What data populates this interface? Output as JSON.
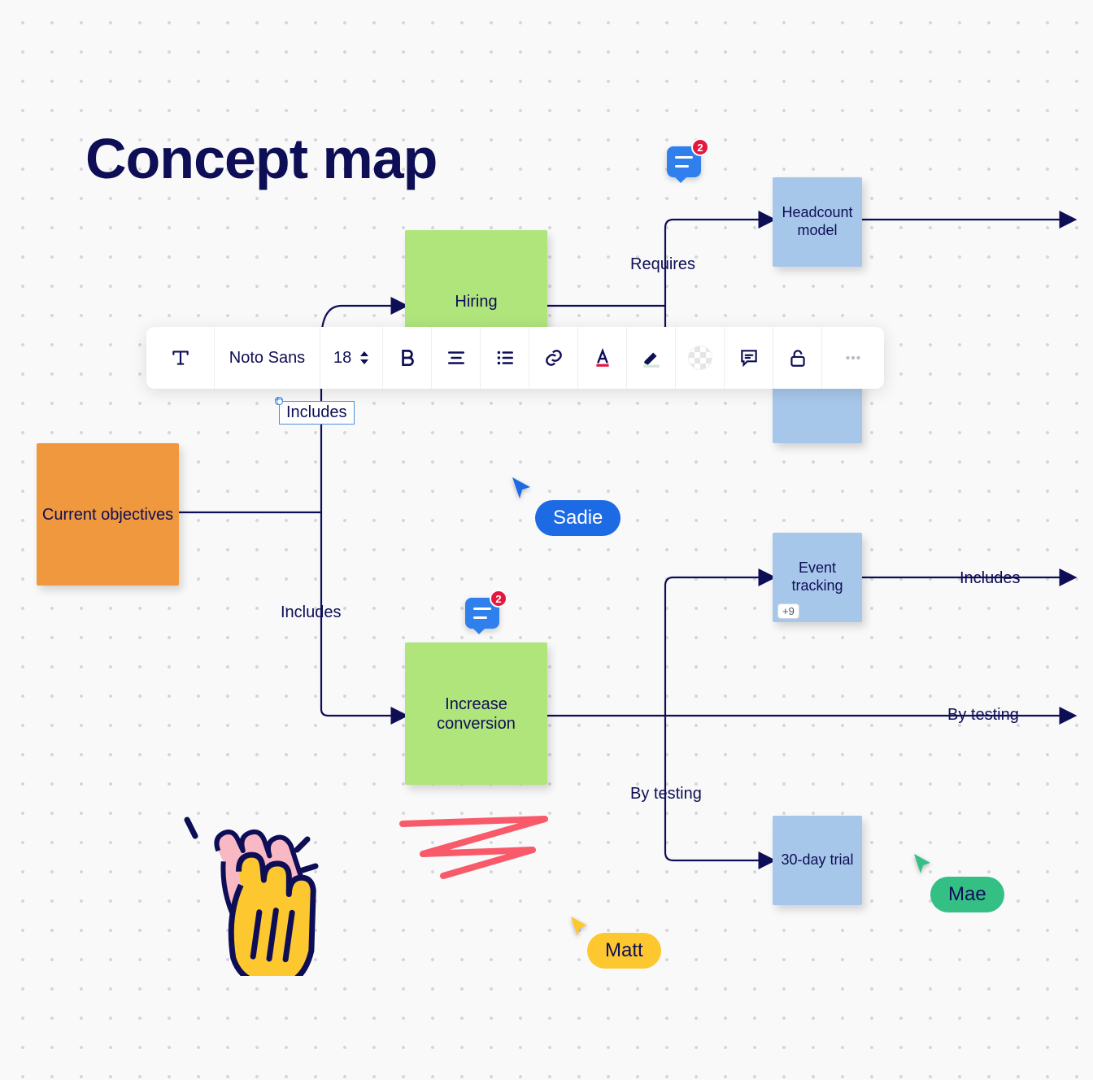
{
  "title": "Concept map",
  "nodes": {
    "current_objectives": "Current objectives",
    "hiring": "Hiring",
    "increase_conversion": "Increase conversion",
    "headcount_model": "Headcount model",
    "event_tracking": "Event tracking",
    "thirty_day_trial": "30-day trial"
  },
  "edges": {
    "includes_top": "Includes",
    "includes_bottom": "Includes",
    "requires": "Requires",
    "by_testing_mid": "By testing",
    "includes_right": "Includes",
    "by_testing_right": "By testing"
  },
  "toolbar": {
    "font_family": "Noto Sans",
    "font_size": "18"
  },
  "comments": {
    "top_count": "2",
    "bottom_count": "2"
  },
  "collaborators": {
    "sadie": "Sadie",
    "matt": "Matt",
    "mae": "Mae"
  },
  "misc": {
    "plus_badge": "+9"
  }
}
